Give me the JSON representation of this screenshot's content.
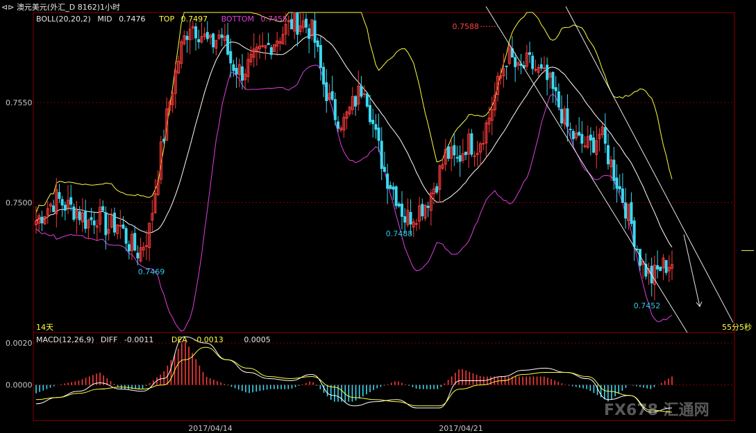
{
  "window": {
    "title": "澳元美元(外汇_D 8162)1小时",
    "back_glyph": "⊲⊳"
  },
  "colors": {
    "candle_up": "#ff3b3b",
    "candle_down": "#3cd8f0",
    "mid": "#ffffff",
    "top": "#ffff40",
    "bottom": "#e040e0",
    "frame": "#8b0000",
    "grid": "#8b0000",
    "diff": "#ffffff",
    "dea": "#ffff40",
    "trendline": "#e8e8e8"
  },
  "boll_header": {
    "name": "BOLL(20,20,2)",
    "mid_label": "MID",
    "mid_value": "0.7476",
    "top_label": "TOP",
    "top_value": "0.7497",
    "bottom_label": "BOTTOM",
    "bottom_value": "0.7455"
  },
  "macd_header": {
    "name": "MACD(12,26,9)",
    "diff_label": "DIFF",
    "diff_value": "-0.0011",
    "dea_label": "DEA",
    "dea_value": "-0.0013",
    "macd_value": "0.0005"
  },
  "footer": {
    "days": "14天",
    "countdown": "55分5秒",
    "watermark": "FX678 汇通网"
  },
  "chart_data": [
    {
      "type": "candlestick",
      "title": "澳元美元(外汇_D 8162)1小时",
      "ylim": [
        0.7435,
        0.7595
      ],
      "yticks": [
        0.75,
        0.755
      ],
      "ytick_labels": [
        "0.7500",
        "0.7550"
      ],
      "xtick_labels": [
        "2017/04/14",
        "2017/04/21"
      ],
      "grid": true,
      "price_path": [
        0.7491,
        0.7497,
        0.7502,
        0.7498,
        0.7496,
        0.749,
        0.7494,
        0.7487,
        0.749,
        0.748,
        0.7475,
        0.7485,
        0.752,
        0.755,
        0.7575,
        0.759,
        0.7585,
        0.7578,
        0.7585,
        0.757,
        0.7565,
        0.757,
        0.7575,
        0.758,
        0.7585,
        0.759,
        0.759,
        0.7585,
        0.756,
        0.7545,
        0.754,
        0.755,
        0.756,
        0.7535,
        0.7515,
        0.7505,
        0.7492,
        0.7495,
        0.75,
        0.751,
        0.7525,
        0.752,
        0.753,
        0.7528,
        0.754,
        0.7558,
        0.7575,
        0.7565,
        0.757,
        0.7565,
        0.756,
        0.7548,
        0.7535,
        0.753,
        0.7528,
        0.7535,
        0.752,
        0.7505,
        0.749,
        0.747,
        0.7462,
        0.7468,
        0.747
      ],
      "annotations": [
        {
          "label": "0.7469",
          "value": 0.7469
        },
        {
          "label": "0.7488",
          "value": 0.7488
        },
        {
          "label": "0.7588",
          "value": 0.7588
        },
        {
          "label": "0.7452",
          "value": 0.7452
        }
      ],
      "overlays": [
        "BOLL MID",
        "BOLL TOP",
        "BOLL BOTTOM",
        "descending trend channel"
      ]
    },
    {
      "type": "bar",
      "title": "MACD(12,26,9)",
      "ylim": [
        -0.0017,
        0.0025
      ],
      "yticks": [
        0.0,
        0.002
      ],
      "ytick_labels": [
        "0.0000",
        "0.0020"
      ],
      "series": [
        {
          "name": "DIFF",
          "values": [
            -0.0009,
            -0.0006,
            -0.0003,
            0.0001,
            -0.0002,
            -0.0003,
            0.0003,
            0.0023,
            0.002,
            0.0012,
            0.0006,
            0.0003,
            0.0002,
            0.0005,
            -0.0005,
            -0.001,
            -0.0008,
            -0.0007,
            -0.0011,
            -0.0011,
            0.0002,
            0.0002,
            0.0004,
            0.0007,
            0.0008,
            0.0006,
            0.0003,
            -0.0007,
            -0.0005,
            -0.0013,
            -0.0011
          ]
        },
        {
          "name": "DEA",
          "values": [
            -0.0007,
            -0.0006,
            -0.0004,
            -0.0002,
            -0.0001,
            -0.0002,
            0.0,
            0.0012,
            0.0018,
            0.0012,
            0.0008,
            0.0004,
            0.0003,
            0.0004,
            -0.0001,
            -0.0006,
            -0.0007,
            -0.0008,
            -0.001,
            -0.001,
            -0.0002,
            0.0,
            0.0002,
            0.0005,
            0.0006,
            0.0006,
            0.0004,
            -0.0003,
            -0.0005,
            -0.0012,
            -0.0013
          ]
        }
      ]
    }
  ]
}
